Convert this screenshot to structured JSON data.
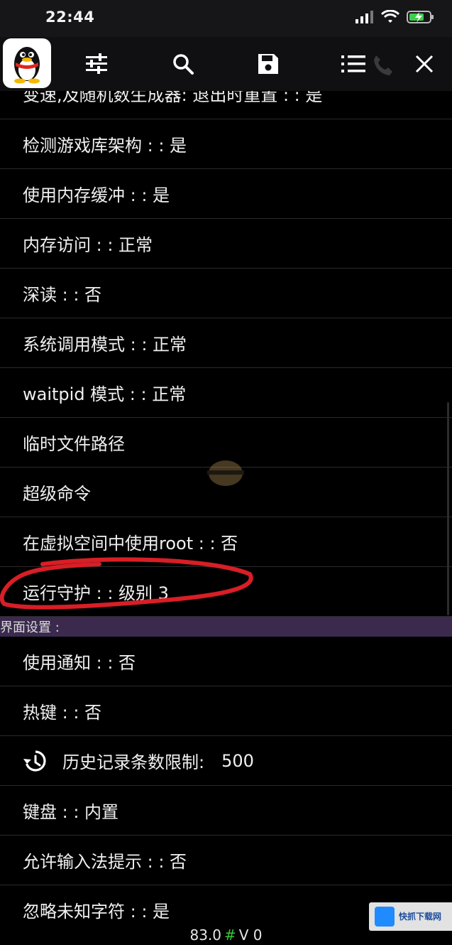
{
  "status_bar": {
    "time": "22:44"
  },
  "toolbar": {
    "items": [
      "settings",
      "search",
      "save",
      "list",
      "close"
    ]
  },
  "settings_list": [
    {
      "label": "变速,及随机数生成器: 退出时重置 : : 是",
      "partial": true
    },
    {
      "label": "检测游戏库架构 : : 是"
    },
    {
      "label": "使用内存缓冲 : : 是"
    },
    {
      "label": "内存访问 : : 正常"
    },
    {
      "label": "深读 : : 否"
    },
    {
      "label": "系统调用模式 : : 正常"
    },
    {
      "label": "waitpid 模式 : : 正常"
    },
    {
      "label": "临时文件路径"
    },
    {
      "label": "超级命令"
    },
    {
      "label": "在虚拟空间中使用root : : 否"
    },
    {
      "label": "运行守护 : : 级别 3"
    }
  ],
  "section_interface": {
    "header": "界面设置 :"
  },
  "interface_list": [
    {
      "label": "使用通知 : : 否"
    },
    {
      "label": "热键 : : 否"
    },
    {
      "label": "历史记录条数限制:",
      "value": "500",
      "icon": "history-icon"
    },
    {
      "label": "键盘 : : 内置"
    },
    {
      "label": "允许输入法提示 : : 否"
    },
    {
      "label": "忽略未知字符 : : 是"
    }
  ],
  "footer": {
    "left": "83.0",
    "hash": "#",
    "right": "V 0"
  },
  "watermark": {
    "title": "快抓下载网"
  },
  "colors": {
    "background": "#000000",
    "section": "#3b2a4e",
    "annotation": "#d81e26",
    "footer_hash": "#37c837"
  }
}
